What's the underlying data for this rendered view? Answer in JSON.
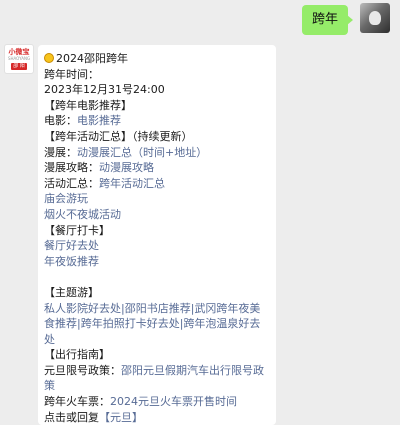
{
  "user_message": "跨年",
  "bot": {
    "avatar_logo": "小微宝",
    "avatar_sub": "SHAOYANG",
    "avatar_badge": "邵 阳"
  },
  "reply": {
    "title": "2024邵阳跨年",
    "time_label": "跨年时间：",
    "time_value": "2023年12月31号24:00",
    "movie_header": "【跨年电影推荐】",
    "movie_label": "电影：",
    "movie_link": "电影推荐",
    "events_header": "【跨年活动汇总】（持续更新）",
    "exhibit_label": "漫展：",
    "exhibit_link": "动漫展汇总（时间+地址）",
    "exhibit_guide_label": "漫展攻略：",
    "exhibit_guide_link": "动漫展攻略",
    "events_label": "活动汇总：",
    "events_link": "跨年活动汇总",
    "temple_fair_link": "庙会游玩",
    "fireworks_link": "烟火不夜城活动",
    "dining_header": "【餐厅打卡】",
    "dining_link1": "餐厅好去处",
    "dining_link2": "年夜饭推荐",
    "theme_header": "【主题游】",
    "theme_link1": "私人影院好去处",
    "sep1": "|",
    "theme_link2": "邵阳书店推荐",
    "sep2": "|",
    "theme_link3": "武冈跨年夜美食推荐",
    "sep3": "|",
    "theme_link4": "跨年拍照打卡好去处",
    "sep4": "|",
    "theme_link5": "跨年泡温泉好去处",
    "travel_header": "【出行指南】",
    "restriction_label": "元旦限号政策：",
    "restriction_link": "邵阳元旦假期汽车出行限号政策",
    "train_label": "跨年火车票：",
    "train_link": "2024元旦火车票开售时间",
    "reply_hint_label": "点击或回复",
    "reply_hint_link": "【元旦】"
  }
}
